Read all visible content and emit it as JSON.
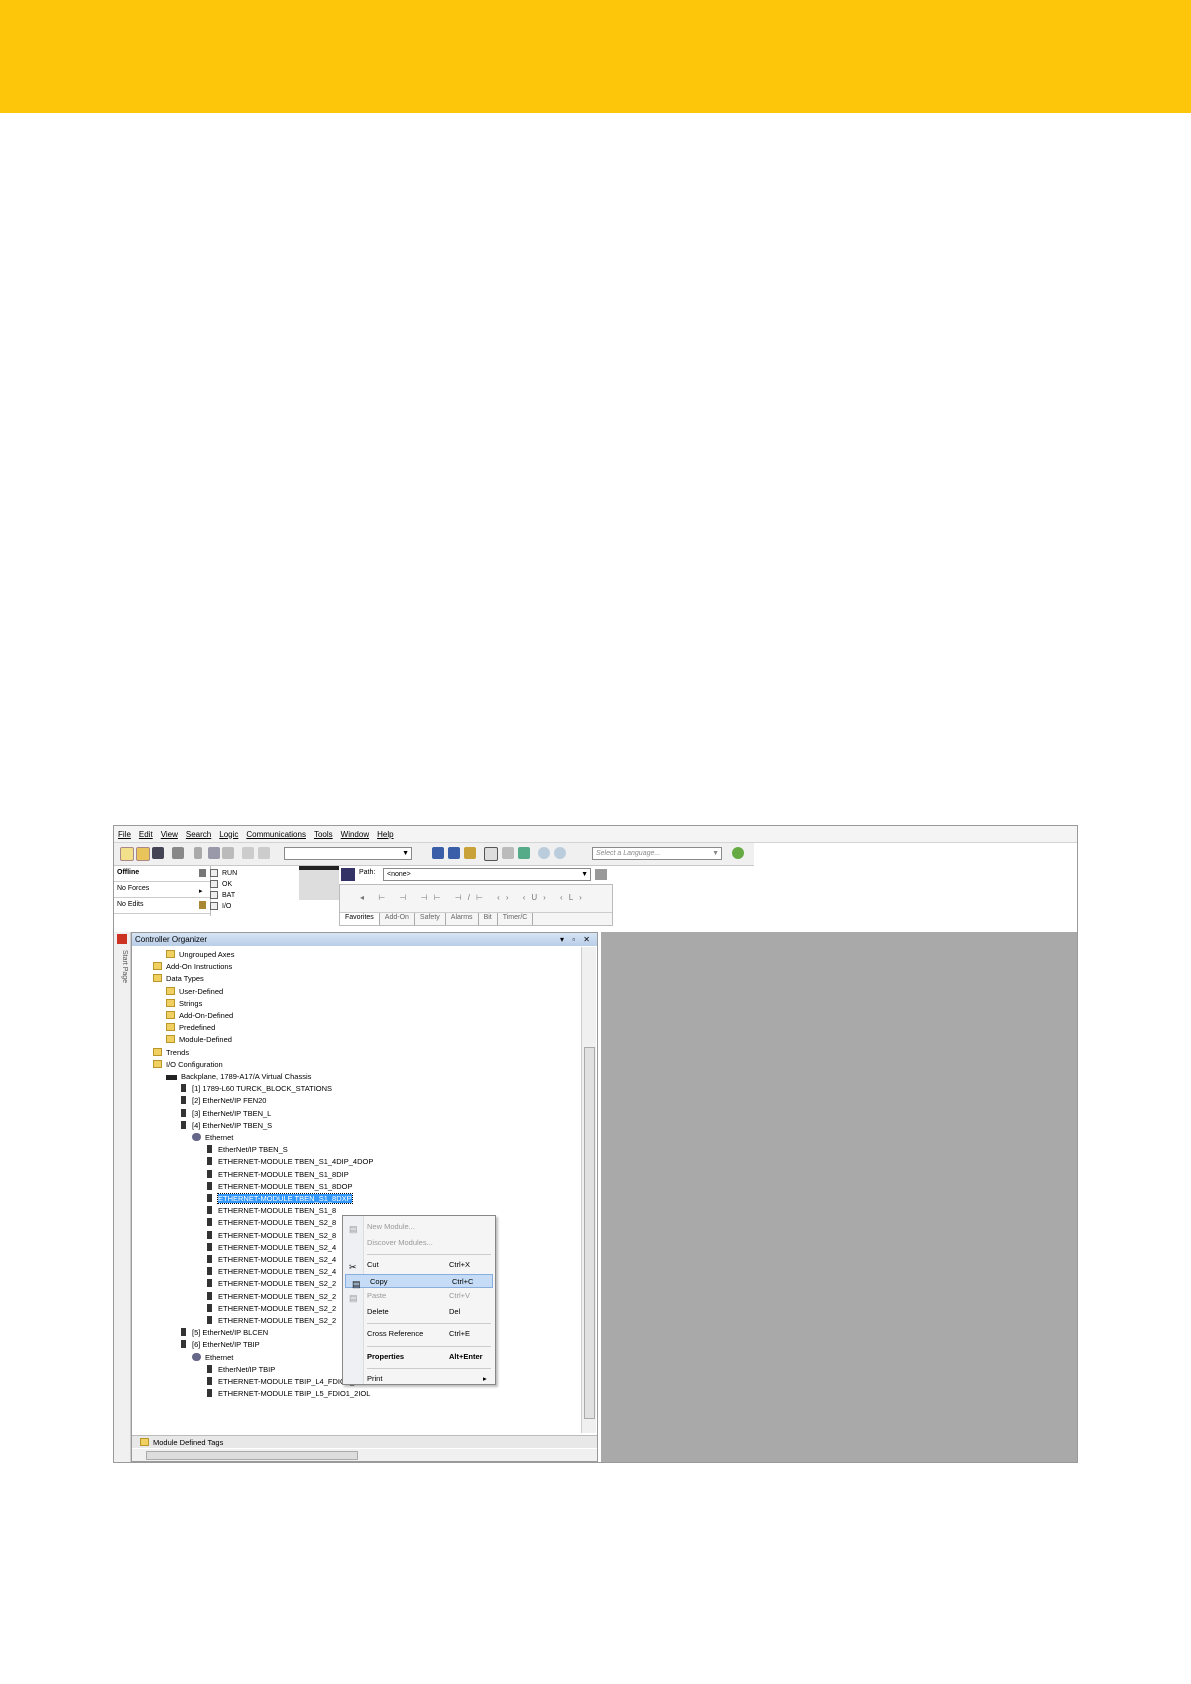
{
  "menubar": [
    "File",
    "Edit",
    "View",
    "Search",
    "Logic",
    "Communications",
    "Tools",
    "Window",
    "Help"
  ],
  "toolbar": {
    "language_placeholder": "Select a Language..."
  },
  "status": {
    "mode": "Offline",
    "forces": "No Forces",
    "edits": "No Edits"
  },
  "leds": [
    "RUN",
    "OK",
    "BAT",
    "I/O"
  ],
  "path": {
    "label": "Path:",
    "value": "<none>"
  },
  "ladder_tabs": [
    "Favorites",
    "Add-On",
    "Safety",
    "Alarms",
    "Bit",
    "Timer/C"
  ],
  "organizer": {
    "title": "Controller Organizer",
    "start_page": "Start Page",
    "bottom": "Module Defined Tags",
    "tree": [
      {
        "label": "Ungrouped Axes",
        "indent": 2,
        "icon": "folder"
      },
      {
        "label": "Add-On Instructions",
        "indent": 1,
        "icon": "folder"
      },
      {
        "label": "Data Types",
        "indent": 1,
        "icon": "folder"
      },
      {
        "label": "User-Defined",
        "indent": 2,
        "icon": "folder"
      },
      {
        "label": "Strings",
        "indent": 2,
        "icon": "folder"
      },
      {
        "label": "Add-On-Defined",
        "indent": 2,
        "icon": "folder"
      },
      {
        "label": "Predefined",
        "indent": 2,
        "icon": "folder"
      },
      {
        "label": "Module-Defined",
        "indent": 2,
        "icon": "folder"
      },
      {
        "label": "Trends",
        "indent": 1,
        "icon": "folder"
      },
      {
        "label": "I/O Configuration",
        "indent": 1,
        "icon": "folder"
      },
      {
        "label": "Backplane, 1789-A17/A Virtual Chassis",
        "indent": 2,
        "icon": "chassis"
      },
      {
        "label": "[1] 1789-L60 TURCK_BLOCK_STATIONS",
        "indent": 3,
        "icon": "module"
      },
      {
        "label": "[2] EtherNet/IP FEN20",
        "indent": 3,
        "icon": "module"
      },
      {
        "label": "[3] EtherNet/IP TBEN_L",
        "indent": 3,
        "icon": "module"
      },
      {
        "label": "[4] EtherNet/IP TBEN_S",
        "indent": 3,
        "icon": "module"
      },
      {
        "label": "Ethernet",
        "indent": 4,
        "icon": "net"
      },
      {
        "label": "EtherNet/IP TBEN_S",
        "indent": 5,
        "icon": "module"
      },
      {
        "label": "ETHERNET-MODULE TBEN_S1_4DIP_4DOP",
        "indent": 5,
        "icon": "module"
      },
      {
        "label": "ETHERNET-MODULE TBEN_S1_8DIP",
        "indent": 5,
        "icon": "module"
      },
      {
        "label": "ETHERNET-MODULE TBEN_S1_8DOP",
        "indent": 5,
        "icon": "module"
      },
      {
        "label": "ETHERNET-MODULE TBEN_S1_8DXP",
        "indent": 5,
        "icon": "module",
        "selected": true
      },
      {
        "label": "ETHERNET-MODULE TBEN_S1_8",
        "indent": 5,
        "icon": "module"
      },
      {
        "label": "ETHERNET-MODULE TBEN_S2_8",
        "indent": 5,
        "icon": "module"
      },
      {
        "label": "ETHERNET-MODULE TBEN_S2_8",
        "indent": 5,
        "icon": "module"
      },
      {
        "label": "ETHERNET-MODULE TBEN_S2_4",
        "indent": 5,
        "icon": "module"
      },
      {
        "label": "ETHERNET-MODULE TBEN_S2_4",
        "indent": 5,
        "icon": "module"
      },
      {
        "label": "ETHERNET-MODULE TBEN_S2_4",
        "indent": 5,
        "icon": "module"
      },
      {
        "label": "ETHERNET-MODULE TBEN_S2_2",
        "indent": 5,
        "icon": "module"
      },
      {
        "label": "ETHERNET-MODULE TBEN_S2_2",
        "indent": 5,
        "icon": "module"
      },
      {
        "label": "ETHERNET-MODULE TBEN_S2_2",
        "indent": 5,
        "icon": "module"
      },
      {
        "label": "ETHERNET-MODULE TBEN_S2_2",
        "indent": 5,
        "icon": "module"
      },
      {
        "label": "[5] EtherNet/IP BLCEN",
        "indent": 3,
        "icon": "module"
      },
      {
        "label": "[6] EtherNet/IP TBIP",
        "indent": 3,
        "icon": "module"
      },
      {
        "label": "Ethernet",
        "indent": 4,
        "icon": "net"
      },
      {
        "label": "EtherNet/IP TBIP",
        "indent": 5,
        "icon": "module"
      },
      {
        "label": "ETHERNET-MODULE TBIP_L4_FDIO1_2IOL",
        "indent": 5,
        "icon": "module"
      },
      {
        "label": "ETHERNET-MODULE TBIP_L5_FDIO1_2IOL",
        "indent": 5,
        "icon": "module"
      }
    ]
  },
  "context_menu": [
    {
      "label": "New Module...",
      "shortcut": "",
      "disabled": true
    },
    {
      "label": "Discover Modules...",
      "shortcut": "",
      "disabled": true
    },
    {
      "sep": true
    },
    {
      "label": "Cut",
      "shortcut": "Ctrl+X"
    },
    {
      "label": "Copy",
      "shortcut": "Ctrl+C",
      "highlight": true
    },
    {
      "label": "Paste",
      "shortcut": "Ctrl+V",
      "disabled": true
    },
    {
      "label": "Delete",
      "shortcut": "Del"
    },
    {
      "sep": true
    },
    {
      "label": "Cross Reference",
      "shortcut": "Ctrl+E"
    },
    {
      "sep": true
    },
    {
      "label": "Properties",
      "shortcut": "Alt+Enter",
      "bold": true
    },
    {
      "sep": true
    },
    {
      "label": "Print",
      "shortcut": "▸"
    }
  ],
  "colors": {
    "banner": "#fdc60b",
    "selection": "#3399ff",
    "workspace": "#a9a9a9"
  }
}
